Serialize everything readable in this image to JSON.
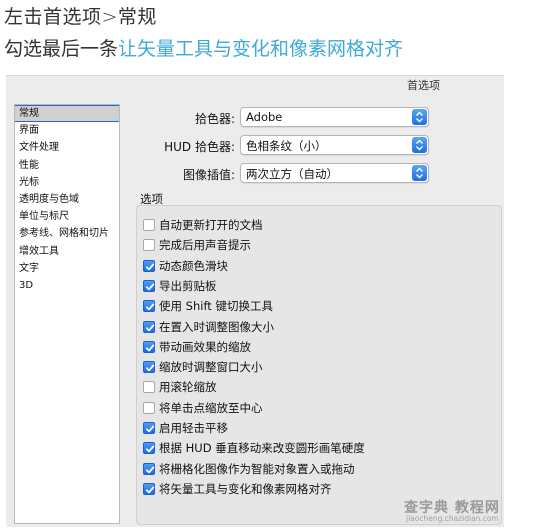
{
  "page": {
    "heading_line1": "左击首选项>常规",
    "heading_line2_plain": "勾选最后一条",
    "heading_line2_accent": "让矢量工具与变化和像素网格对齐",
    "accent_color": "#3fa9d8"
  },
  "window": {
    "title": "首选项"
  },
  "sidebar": {
    "items": [
      {
        "label": "常规",
        "selected": true
      },
      {
        "label": "界面"
      },
      {
        "label": "文件处理"
      },
      {
        "label": "性能"
      },
      {
        "label": "光标"
      },
      {
        "label": "透明度与色域"
      },
      {
        "label": "单位与标尺"
      },
      {
        "label": "参考线、网格和切片"
      },
      {
        "label": "增效工具"
      },
      {
        "label": "文字"
      },
      {
        "label": "3D"
      }
    ]
  },
  "settings": {
    "color_picker": {
      "label": "拾色器:",
      "value": "Adobe"
    },
    "hud_color_picker": {
      "label": "HUD 拾色器:",
      "value": "色相条纹（小）"
    },
    "image_interpolation": {
      "label": "图像插值:",
      "value": "两次立方（自动）"
    }
  },
  "options": {
    "section_label": "选项",
    "items": [
      {
        "label": "自动更新打开的文档",
        "checked": false
      },
      {
        "label": "完成后用声音提示",
        "checked": false
      },
      {
        "label": "动态颜色滑块",
        "checked": true
      },
      {
        "label": "导出剪贴板",
        "checked": true
      },
      {
        "label": "使用 Shift 键切换工具",
        "checked": true
      },
      {
        "label": "在置入时调整图像大小",
        "checked": true
      },
      {
        "label": "带动画效果的缩放",
        "checked": true
      },
      {
        "label": "缩放时调整窗口大小",
        "checked": true
      },
      {
        "label": "用滚轮缩放",
        "checked": false
      },
      {
        "label": "将单击点缩放至中心",
        "checked": false
      },
      {
        "label": "启用轻击平移",
        "checked": true
      },
      {
        "label": "根据 HUD 垂直移动来改变圆形画笔硬度",
        "checked": true
      },
      {
        "label": "将栅格化图像作为智能对象置入或拖动",
        "checked": true
      },
      {
        "label": "将矢量工具与变化和像素网格对齐",
        "checked": true
      }
    ]
  },
  "watermark": {
    "main": "查字典 教程网",
    "sub": "jiaocheng.chazidian.com"
  }
}
